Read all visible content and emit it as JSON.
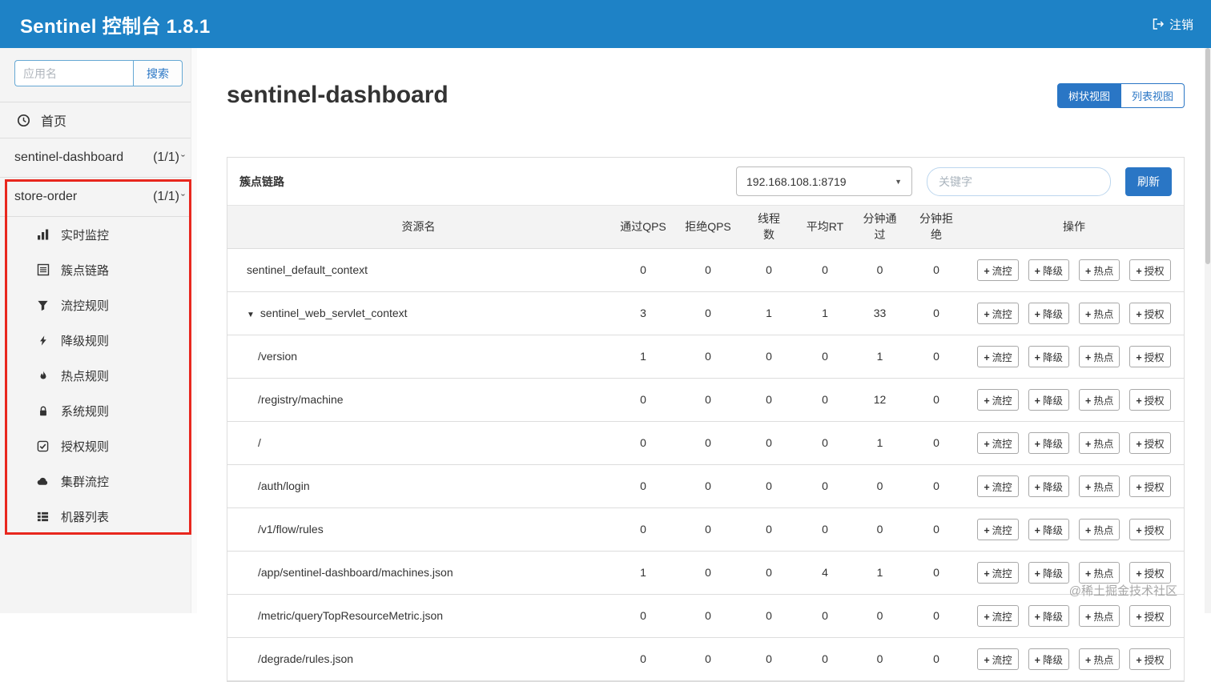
{
  "header": {
    "title": "Sentinel 控制台 1.8.1",
    "logout_label": "注销"
  },
  "icons": {
    "chevron": "ˇ",
    "select_caret": "▼",
    "expand_triangle": "▼",
    "plus": "+"
  },
  "sidebar": {
    "search": {
      "placeholder": "应用名",
      "button_label": "搜索"
    },
    "home_label": "首页",
    "apps": [
      {
        "label": "sentinel-dashboard",
        "count": "(1/1)"
      },
      {
        "label": "store-order",
        "count": "(1/1)"
      }
    ],
    "menu_items": [
      {
        "id": "realtime-monitoring",
        "label": "实时监控",
        "icon": "chart-bar-icon"
      },
      {
        "id": "cluster-link",
        "label": "簇点链路",
        "icon": "list-board-icon"
      },
      {
        "id": "flow-rules",
        "label": "流控规则",
        "icon": "filter-icon"
      },
      {
        "id": "degrade-rules",
        "label": "降级规则",
        "icon": "bolt-icon"
      },
      {
        "id": "hotspot-rules",
        "label": "热点规则",
        "icon": "flame-icon"
      },
      {
        "id": "system-rules",
        "label": "系统规则",
        "icon": "lock-icon"
      },
      {
        "id": "authority-rules",
        "label": "授权规则",
        "icon": "check-square-icon"
      },
      {
        "id": "cluster-flow",
        "label": "集群流控",
        "icon": "cloud-icon"
      },
      {
        "id": "machine-list",
        "label": "机器列表",
        "icon": "th-list-icon"
      }
    ]
  },
  "main": {
    "page_title": "sentinel-dashboard",
    "view_toggle": {
      "tree_label": "树状视图",
      "list_label": "列表视图"
    },
    "panel": {
      "title": "簇点链路",
      "machine_select_value": "192.168.108.1:8719",
      "keyword_placeholder": "关键字",
      "refresh_label": "刷新"
    },
    "table": {
      "headers": [
        "资源名",
        "通过QPS",
        "拒绝QPS",
        "线程数",
        "平均RT",
        "分钟通过",
        "分钟拒绝",
        "操作"
      ],
      "action_buttons": [
        "流控",
        "降级",
        "热点",
        "授权"
      ],
      "rows": [
        {
          "resource": "sentinel_default_context",
          "indent": 0,
          "expandable": false,
          "values": [
            0,
            0,
            0,
            0,
            0,
            0
          ]
        },
        {
          "resource": "sentinel_web_servlet_context",
          "indent": 0,
          "expandable": true,
          "values": [
            3,
            0,
            1,
            1,
            33,
            0
          ]
        },
        {
          "resource": "/version",
          "indent": 1,
          "expandable": false,
          "values": [
            1,
            0,
            0,
            0,
            1,
            0
          ]
        },
        {
          "resource": "/registry/machine",
          "indent": 1,
          "expandable": false,
          "values": [
            0,
            0,
            0,
            0,
            12,
            0
          ]
        },
        {
          "resource": "/",
          "indent": 1,
          "expandable": false,
          "values": [
            0,
            0,
            0,
            0,
            1,
            0
          ]
        },
        {
          "resource": "/auth/login",
          "indent": 1,
          "expandable": false,
          "values": [
            0,
            0,
            0,
            0,
            0,
            0
          ]
        },
        {
          "resource": "/v1/flow/rules",
          "indent": 1,
          "expandable": false,
          "values": [
            0,
            0,
            0,
            0,
            0,
            0
          ]
        },
        {
          "resource": "/app/sentinel-dashboard/machines.json",
          "indent": 1,
          "expandable": false,
          "values": [
            1,
            0,
            0,
            4,
            1,
            0
          ]
        },
        {
          "resource": "/metric/queryTopResourceMetric.json",
          "indent": 1,
          "expandable": false,
          "values": [
            0,
            0,
            0,
            0,
            0,
            0
          ]
        },
        {
          "resource": "/degrade/rules.json",
          "indent": 1,
          "expandable": false,
          "values": [
            0,
            0,
            0,
            0,
            0,
            0
          ]
        }
      ]
    }
  },
  "watermark": "@稀土掘金技术社区",
  "colors": {
    "header_bg": "#1e82c6",
    "accent": "#2a76c5",
    "annotation": "#e8271e"
  }
}
